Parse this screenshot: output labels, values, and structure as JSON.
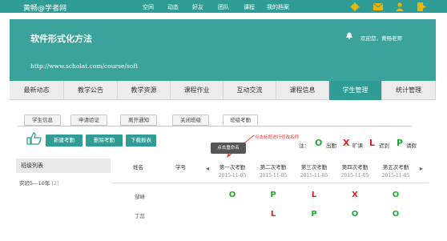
{
  "topbar": {
    "brand": "黄畅@学者网",
    "nav": [
      "空间",
      "动态",
      "好友",
      "团队",
      "课程",
      "我的档案"
    ],
    "colors": {
      "bar": "#2f9c96",
      "icons": "#f0b400"
    }
  },
  "header": {
    "title": "软件形式化方法",
    "url": "http://www.scholat.com/course/soft",
    "welcome": "欢迎您，黄畅老师"
  },
  "main_tabs": [
    {
      "label": "最新动态"
    },
    {
      "label": "教学公告"
    },
    {
      "label": "教学资源"
    },
    {
      "label": "课程作业"
    },
    {
      "label": "互动交流"
    },
    {
      "label": "课程信息"
    },
    {
      "label": "学生管理",
      "active": true
    },
    {
      "label": "统计管理"
    }
  ],
  "sub_tabs": [
    {
      "label": "学生信息"
    },
    {
      "label": "申请验证"
    },
    {
      "label": "离开通知"
    },
    {
      "label": "关闭班级"
    },
    {
      "label": "班级考勤",
      "active": true
    }
  ],
  "toolbar": {
    "new_label": "新建考勤",
    "delete_label": "删除考勤",
    "download_label": "下载报表",
    "hint": "点击标题进行修改名称",
    "tooltip": "点击重命名"
  },
  "legend": {
    "prefix": "注：",
    "items": [
      {
        "symbol": "O",
        "label": "出勤",
        "color": "#22aa33"
      },
      {
        "symbol": "X",
        "label": "旷课",
        "color": "#e02020"
      },
      {
        "symbol": "L",
        "label": "迟到",
        "color": "#e02020"
      },
      {
        "symbol": "P",
        "label": "请假",
        "color": "#22aa33"
      }
    ]
  },
  "class_list": {
    "title": "班级列表",
    "items": [
      {
        "name": "实验5—10年",
        "count": "[2]"
      }
    ]
  },
  "table": {
    "col_name": "姓名",
    "col_id": "学号",
    "sessions": [
      {
        "title": "第一次考勤",
        "date": "2015-11-05"
      },
      {
        "title": "第二次考勤",
        "date": "2015-11-05"
      },
      {
        "title": "第三次考勤",
        "date": "2015-11-05"
      },
      {
        "title": "第四次考勤",
        "date": "2015-11-05"
      },
      {
        "title": "第五次考勤",
        "date": "2015-11-05"
      }
    ],
    "rows": [
      {
        "name": "邹峰",
        "marks": [
          "O",
          "P",
          "L",
          "X",
          "O"
        ]
      },
      {
        "name": "丁蕊",
        "marks": [
          "",
          "L",
          "P",
          "O",
          "O"
        ]
      }
    ]
  }
}
